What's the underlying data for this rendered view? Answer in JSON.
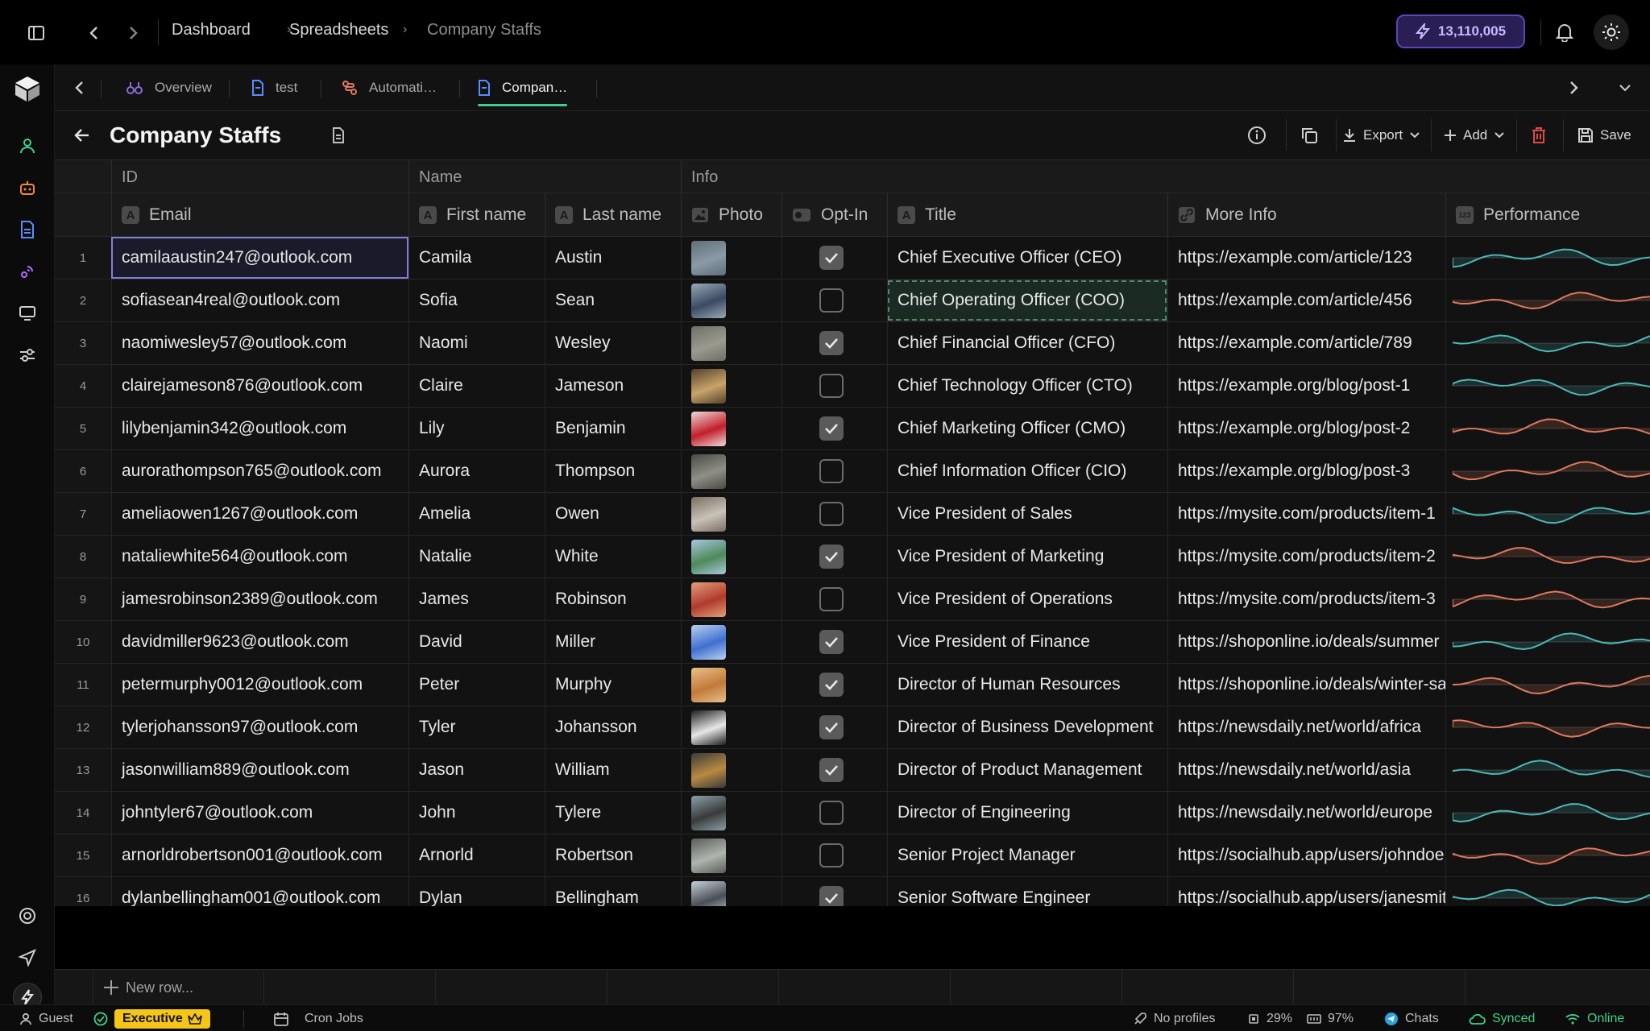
{
  "breadcrumb": [
    "Dashboard",
    "Spreadsheets",
    "Company Staffs"
  ],
  "credits": "13,110,005",
  "tabs": [
    {
      "label": "Overview"
    },
    {
      "label": "test"
    },
    {
      "label": "Automati…"
    },
    {
      "label": "Compan…"
    }
  ],
  "page": {
    "title": "Company Staffs"
  },
  "actions": {
    "export": "Export",
    "add": "Add",
    "save": "Save"
  },
  "groups": {
    "id": "ID",
    "name": "Name",
    "info": "Info"
  },
  "columns": {
    "email": "Email",
    "first_name": "First name",
    "last_name": "Last name",
    "photo": "Photo",
    "optin": "Opt-In",
    "title": "Title",
    "more_info": "More Info",
    "performance": "Performance"
  },
  "rows": [
    {
      "n": "1",
      "email": "camilaaustin247@outlook.com",
      "first": "Camila",
      "last": "Austin",
      "optin": true,
      "title": "Chief Executive Officer (CEO)",
      "url": "https://example.com/article/123"
    },
    {
      "n": "2",
      "email": "sofiasean4real@outlook.com",
      "first": "Sofia",
      "last": "Sean",
      "optin": false,
      "title": "Chief Operating Officer (COO)",
      "url": "https://example.com/article/456"
    },
    {
      "n": "3",
      "email": "naomiwesley57@outlook.com",
      "first": "Naomi",
      "last": "Wesley",
      "optin": true,
      "title": "Chief Financial Officer (CFO)",
      "url": "https://example.com/article/789"
    },
    {
      "n": "4",
      "email": "clairejameson876@outlook.com",
      "first": "Claire",
      "last": "Jameson",
      "optin": false,
      "title": "Chief Technology Officer (CTO)",
      "url": "https://example.org/blog/post-1"
    },
    {
      "n": "5",
      "email": "lilybenjamin342@outlook.com",
      "first": "Lily",
      "last": "Benjamin",
      "optin": true,
      "title": "Chief Marketing Officer (CMO)",
      "url": "https://example.org/blog/post-2"
    },
    {
      "n": "6",
      "email": "aurorathompson765@outlook.com",
      "first": "Aurora",
      "last": "Thompson",
      "optin": false,
      "title": "Chief Information Officer (CIO)",
      "url": "https://example.org/blog/post-3"
    },
    {
      "n": "7",
      "email": "ameliaowen1267@outlook.com",
      "first": "Amelia",
      "last": "Owen",
      "optin": false,
      "title": "Vice President of Sales",
      "url": "https://mysite.com/products/item-1"
    },
    {
      "n": "8",
      "email": "nataliewhite564@outlook.com",
      "first": "Natalie",
      "last": "White",
      "optin": true,
      "title": "Vice President of Marketing",
      "url": "https://mysite.com/products/item-2"
    },
    {
      "n": "9",
      "email": "jamesrobinson2389@outlook.com",
      "first": "James",
      "last": "Robinson",
      "optin": false,
      "title": "Vice President of Operations",
      "url": "https://mysite.com/products/item-3"
    },
    {
      "n": "10",
      "email": "davidmiller9623@outlook.com",
      "first": "David",
      "last": "Miller",
      "optin": true,
      "title": "Vice President of Finance",
      "url": "https://shoponline.io/deals/summer"
    },
    {
      "n": "11",
      "email": "petermurphy0012@outlook.com",
      "first": "Peter",
      "last": "Murphy",
      "optin": true,
      "title": "Director of Human Resources",
      "url": "https://shoponline.io/deals/winter-sale"
    },
    {
      "n": "12",
      "email": "tylerjohansson97@outlook.com",
      "first": "Tyler",
      "last": "Johansson",
      "optin": true,
      "title": "Director of Business Development",
      "url": "https://newsdaily.net/world/africa"
    },
    {
      "n": "13",
      "email": "jasonwilliam889@outlook.com",
      "first": "Jason",
      "last": "William",
      "optin": true,
      "title": "Director of Product Management",
      "url": "https://newsdaily.net/world/asia"
    },
    {
      "n": "14",
      "email": "johntyler67@outlook.com",
      "first": "John",
      "last": "Tylere",
      "optin": false,
      "title": "Director of Engineering",
      "url": "https://newsdaily.net/world/europe"
    },
    {
      "n": "15",
      "email": "arnorldrobertson001@outlook.com",
      "first": "Arnorld",
      "last": "Robertson",
      "optin": false,
      "title": "Senior Project Manager",
      "url": "https://socialhub.app/users/johndoe"
    },
    {
      "n": "16",
      "email": "dylanbellingham001@outlook.com",
      "first": "Dylan",
      "last": "Bellingham",
      "optin": true,
      "title": "Senior Software Engineer",
      "url": "https://socialhub.app/users/janesmith"
    }
  ],
  "new_row": "New row...",
  "status": {
    "user": "Guest",
    "plan": "Executive",
    "cron": "Cron Jobs",
    "profiles": "No profiles",
    "cpu": "29%",
    "mem": "97%",
    "chats": "Chats",
    "synced": "Synced",
    "online": "Online"
  },
  "colors": {
    "accent": "#3fd08b",
    "credits": "#5c45b8",
    "executive": "#f5c518",
    "spark_up": "#4fb8b8",
    "spark_down": "#e07a5f"
  }
}
